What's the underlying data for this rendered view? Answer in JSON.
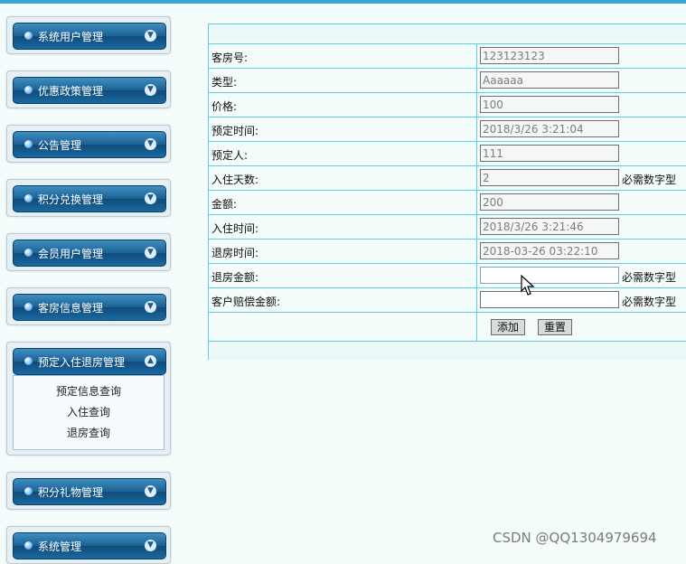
{
  "sidebar": {
    "menus": [
      {
        "label": "系统用户管理"
      },
      {
        "label": "优惠政策管理"
      },
      {
        "label": "公告管理"
      },
      {
        "label": "积分兑换管理"
      },
      {
        "label": "会员用户管理"
      },
      {
        "label": "客房信息管理"
      },
      {
        "label": "预定入住退房管理",
        "items": [
          "预定信息查询",
          "入住查询",
          "退房查询"
        ]
      },
      {
        "label": "积分礼物管理"
      },
      {
        "label": "系统管理"
      }
    ]
  },
  "form": {
    "room_no": {
      "label": "客房号:",
      "value": "123123123"
    },
    "type": {
      "label": "类型:",
      "value": "Aaaaaa"
    },
    "price": {
      "label": "价格:",
      "value": "100"
    },
    "reserve_time": {
      "label": "预定时间:",
      "value": "2018/3/26 3:21:04"
    },
    "reserver": {
      "label": "预定人:",
      "value": "111"
    },
    "stay_days": {
      "label": "入住天数:",
      "value": "2",
      "hint": "必需数字型"
    },
    "amount": {
      "label": "金额:",
      "value": "200"
    },
    "checkin_time": {
      "label": "入住时间:",
      "value": "2018/3/26 3:21:46"
    },
    "checkout_time": {
      "label": "退房时间:",
      "value": "2018-03-26 03:22:10"
    },
    "refund_amount": {
      "label": "退房金额:",
      "value": "",
      "hint": "必需数字型"
    },
    "compensation": {
      "label": "客户赔偿金额:",
      "value": "",
      "hint": "必需数字型"
    },
    "add_label": "添加",
    "reset_label": "重置"
  },
  "watermark": "CSDN @QQ1304979694",
  "colors": {
    "accent": "#3aa7cf",
    "border": "#5fcfe3",
    "menu": "#1b5f92"
  }
}
